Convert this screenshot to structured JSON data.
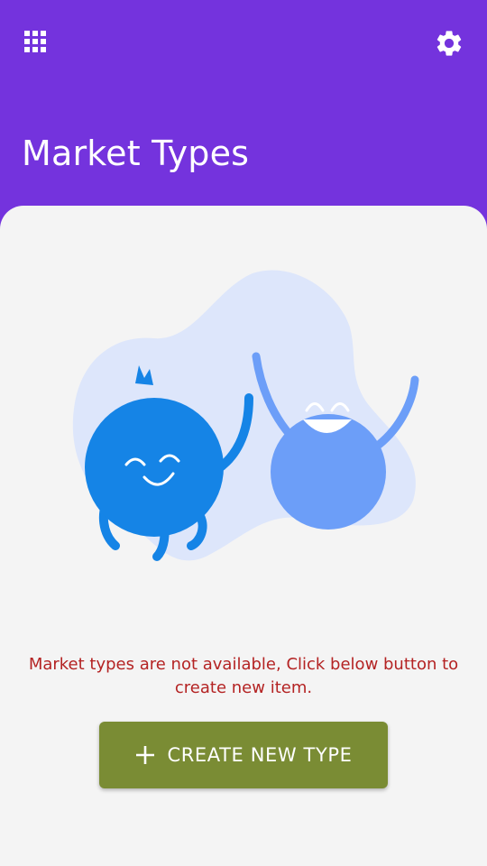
{
  "header": {
    "title": "Market Types",
    "menu_icon": "apps-grid-icon",
    "settings_icon": "gear-icon"
  },
  "empty_state": {
    "illustration": "happy-characters-illustration",
    "message": "Market types are not available, Click below button to create new item."
  },
  "actions": {
    "create_label": "CREATE NEW TYPE",
    "create_icon": "plus-icon"
  },
  "colors": {
    "header_bg": "#7433DD",
    "card_bg": "#F4F4F4",
    "message_text": "#B42323",
    "button_bg": "#7A8C34"
  }
}
